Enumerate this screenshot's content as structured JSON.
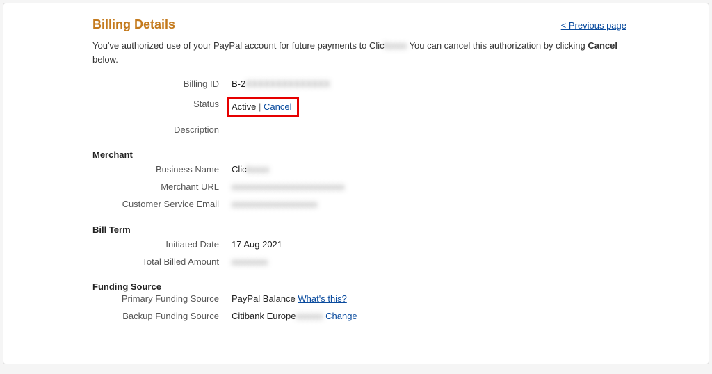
{
  "header": {
    "title": "Billing Details",
    "previous_page": "< Previous page"
  },
  "intro": {
    "part1": "You've authorized use of your PayPal account for future payments to Clic",
    "merchant_blur": "kxxxx",
    "part2": " You can cancel this authorization by clicking ",
    "bold": "Cancel",
    "part3": " below."
  },
  "details": {
    "billing_id_label": "Billing ID",
    "billing_id_prefix": "B-2",
    "billing_id_blur": "XXXXXXXXXXXXXX",
    "status_label": "Status",
    "status_value": "Active",
    "status_separator": "|",
    "cancel_link": "Cancel",
    "description_label": "Description"
  },
  "merchant": {
    "title": "Merchant",
    "business_name_label": "Business Name",
    "business_name_prefix": "Clic",
    "business_name_blur": "kxxxx",
    "merchant_url_label": "Merchant URL",
    "merchant_url_blur": "xxxxxxxxxxxxxxxxxxxxxxxxx",
    "customer_email_label": "Customer Service Email",
    "customer_email_blur": "xxxxxxxxxxxxxxxxxxx"
  },
  "bill_term": {
    "title": "Bill Term",
    "initiated_date_label": "Initiated Date",
    "initiated_date_value": "17 Aug 2021",
    "total_billed_label": "Total Billed Amount",
    "total_billed_blur": "xxxxxxxx"
  },
  "funding": {
    "title": "Funding Source",
    "primary_label": "Primary Funding Source",
    "primary_value": "PayPal Balance",
    "whats_this": "What's this?",
    "backup_label": "Backup Funding Source",
    "backup_prefix": "Citibank Europe",
    "backup_blur": "xxxxxx",
    "change_link": "Change"
  }
}
